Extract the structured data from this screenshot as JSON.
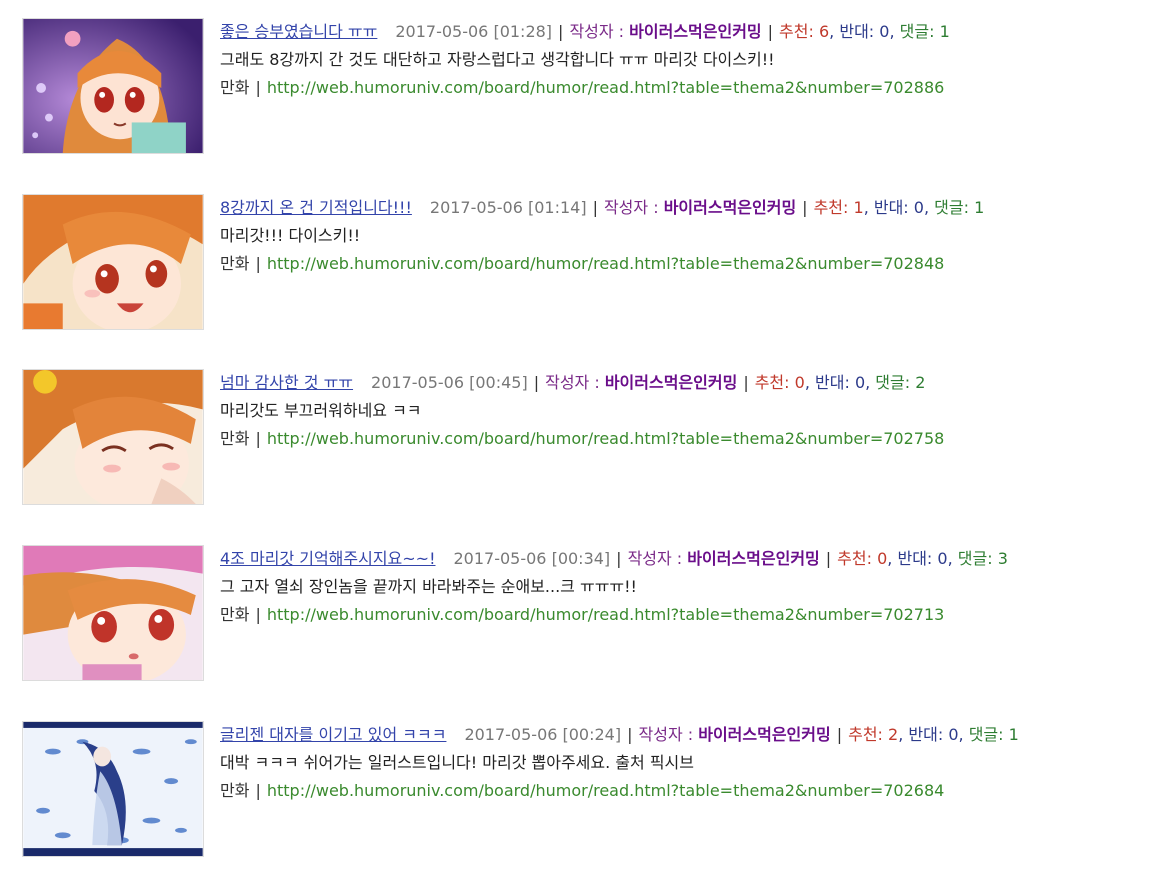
{
  "labels": {
    "author": "작성자 :",
    "recommend": "추천:",
    "oppose": "반대:",
    "comments": "댓글:",
    "separator": "|"
  },
  "colors": {
    "title_link": "#3344aa",
    "author": "#6a0d8a",
    "recommend": "#c0392b",
    "oppose": "#2c3a8a",
    "comments": "#2e7d32",
    "url": "#3a8a2e"
  },
  "posts": [
    {
      "title": "좋은 승부였습니다 ㅠㅠ",
      "date": "2017-05-06 [01:28]",
      "author": "바이러스먹은인커밍",
      "recommend": "6",
      "oppose": "0",
      "comments": "1",
      "body": "그래도 8강까지 간 것도 대단하고 자랑스럽다고 생각합니다 ㅠㅠ 마리갓 다이스키!!",
      "category": "만화",
      "url": "http://web.humoruniv.com/board/humor/read.html?table=thema2&number=702886",
      "thumb_alt": "anime-girl-thumbnail"
    },
    {
      "title": "8강까지 온 건 기적입니다!!!",
      "date": "2017-05-06 [01:14]",
      "author": "바이러스먹은인커밍",
      "recommend": "1",
      "oppose": "0",
      "comments": "1",
      "body": "마리갓!!! 다이스키!!",
      "category": "만화",
      "url": "http://web.humoruniv.com/board/humor/read.html?table=thema2&number=702848",
      "thumb_alt": "anime-girl-thumbnail"
    },
    {
      "title": "넘마 감사한 것 ㅠㅠ",
      "date": "2017-05-06 [00:45]",
      "author": "바이러스먹은인커밍",
      "recommend": "0",
      "oppose": "0",
      "comments": "2",
      "body": "마리갓도 부끄러워하네요 ㅋㅋ",
      "category": "만화",
      "url": "http://web.humoruniv.com/board/humor/read.html?table=thema2&number=702758",
      "thumb_alt": "anime-girl-thumbnail"
    },
    {
      "title": "4조 마리갓 기억해주시지요~~!",
      "date": "2017-05-06 [00:34]",
      "author": "바이러스먹은인커밍",
      "recommend": "0",
      "oppose": "0",
      "comments": "3",
      "body": "그 고자 열쇠 장인놈을 끝까지 바라봐주는 순애보...크 ㅠㅠㅠ!!",
      "category": "만화",
      "url": "http://web.humoruniv.com/board/humor/read.html?table=thema2&number=702713",
      "thumb_alt": "anime-girl-thumbnail"
    },
    {
      "title": "글리젠 대자를 이기고 있어 ㅋㅋㅋ",
      "date": "2017-05-06 [00:24]",
      "author": "바이러스먹은인커밍",
      "recommend": "2",
      "oppose": "0",
      "comments": "1",
      "body": "대박 ㅋㅋㅋ 쉬어가는 일러스트입니다! 마리갓 뽑아주세요. 출처 픽시브",
      "category": "만화",
      "url": "http://web.humoruniv.com/board/humor/read.html?table=thema2&number=702684",
      "thumb_alt": "illustration-thumbnail"
    }
  ]
}
